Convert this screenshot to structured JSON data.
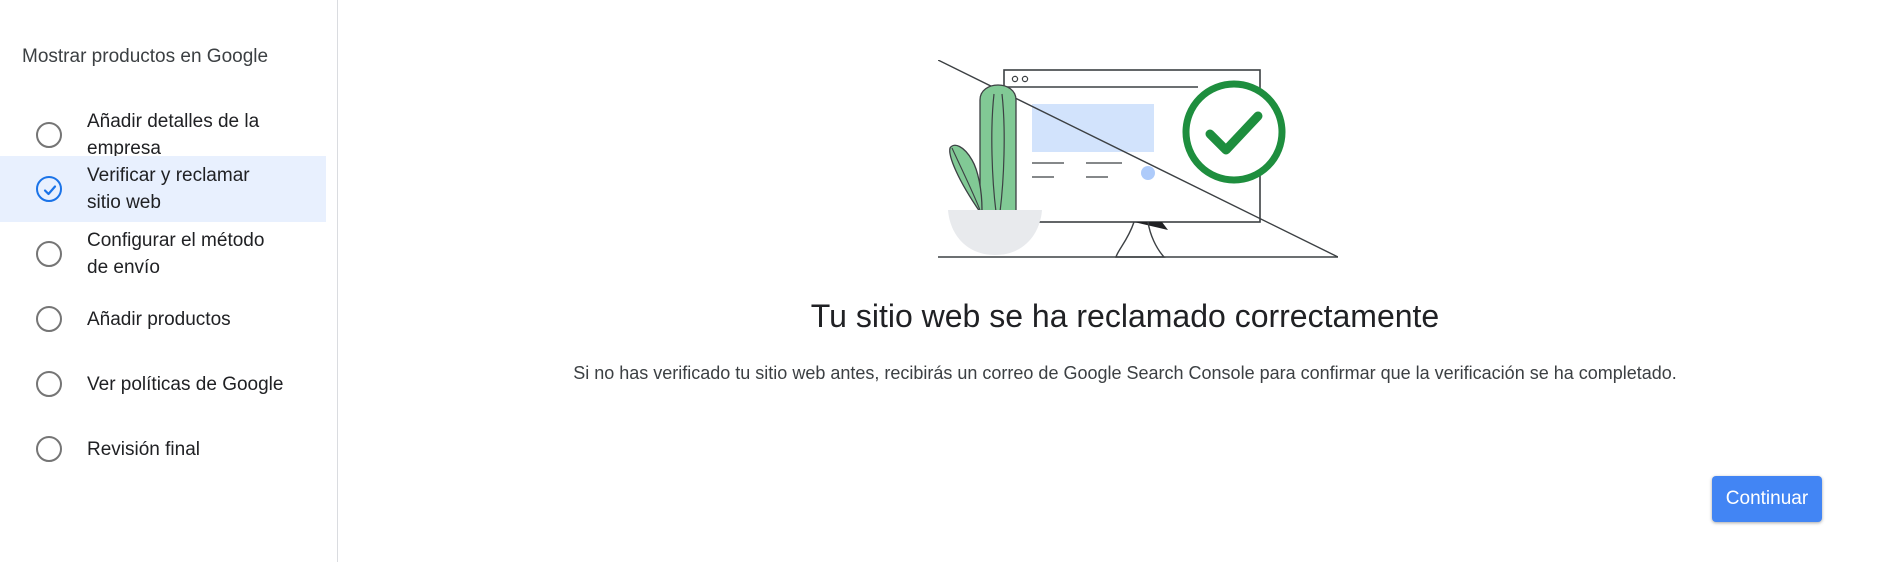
{
  "sidebar": {
    "title": "Mostrar productos en Google",
    "steps": [
      {
        "line1": "Añadir detalles de la",
        "line2": "empresa",
        "state": "pending"
      },
      {
        "line1": "Verificar y reclamar",
        "line2": "sitio web",
        "state": "done"
      },
      {
        "line1": "Configurar el método",
        "line2": "de envío",
        "state": "pending"
      },
      {
        "line1": "Añadir productos",
        "line2": "",
        "state": "pending"
      },
      {
        "line1": "Ver políticas de Google",
        "line2": "",
        "state": "pending"
      },
      {
        "line1": "Revisión final",
        "line2": "",
        "state": "pending"
      }
    ]
  },
  "main": {
    "headline": "Tu sitio web se ha reclamado correctamente",
    "description": "Si no has verificado tu sitio web antes, recibirás un correo de Google Search Console para confirmar que la verificación se ha completado.",
    "continue_label": "Continuar"
  },
  "colors": {
    "accent": "#1a73e8",
    "button": "#4285f4",
    "active_row": "#e8f0fe",
    "success_green": "#1e8e3e"
  },
  "icons": {
    "pending_step": "empty-circle-icon",
    "done_step": "check-circle-icon",
    "illustration": "website-verified-illustration"
  }
}
